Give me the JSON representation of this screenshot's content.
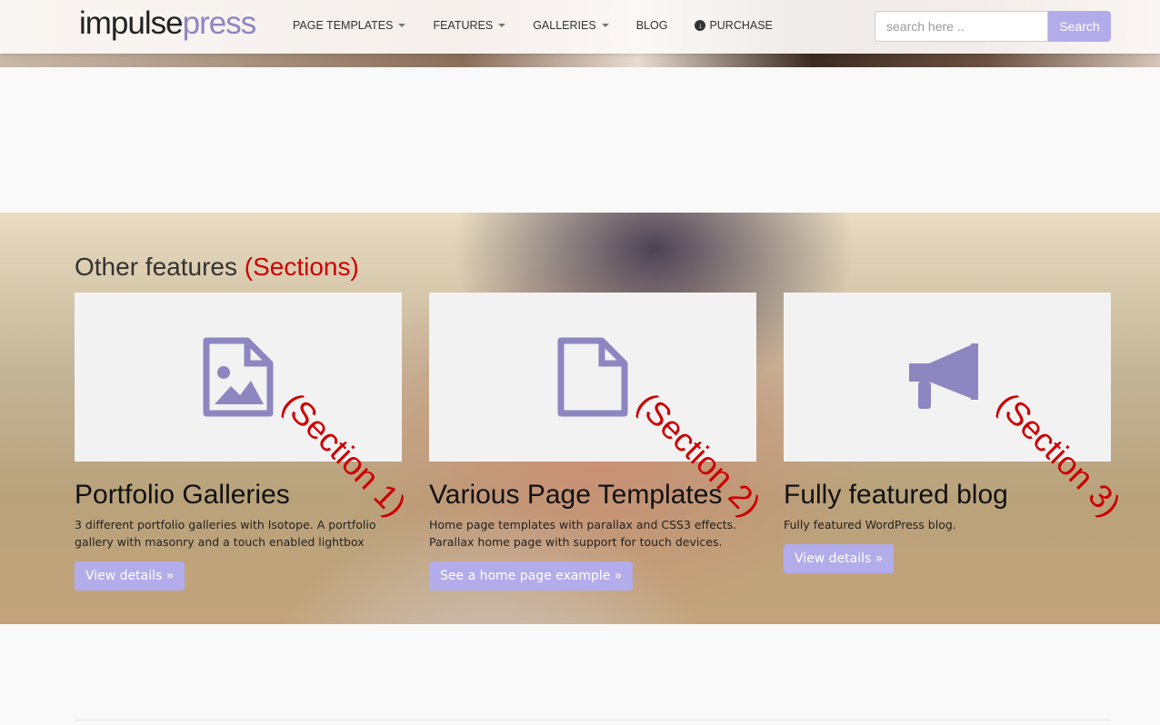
{
  "brand": {
    "part1": "impulse",
    "part2": "press"
  },
  "nav": {
    "items": [
      {
        "label": "PAGE TEMPLATES",
        "dropdown": true
      },
      {
        "label": "FEATURES",
        "dropdown": true
      },
      {
        "label": "GALLERIES",
        "dropdown": true
      },
      {
        "label": "BLOG",
        "dropdown": false
      },
      {
        "label": "PURCHASE",
        "icon": "circle-arrow-down-icon"
      }
    ]
  },
  "search": {
    "placeholder": "search here ..",
    "button": "Search"
  },
  "section": {
    "title": "Other features",
    "annotation": "(Sections)"
  },
  "cards": [
    {
      "icon": "image-file-icon",
      "title": "Portfolio Galleries",
      "text": "3 different portfolio galleries with Isotope. A portfolio gallery with masonry and a touch enabled lightbox",
      "button": "View details »",
      "annotation": "(Section 1)"
    },
    {
      "icon": "file-icon",
      "title": "Various Page Templates",
      "text": "Home page templates with parallax and CSS3 effects. Parallax home page with support for touch devices.",
      "button": "See a home page example »",
      "annotation": "(Section 2)"
    },
    {
      "icon": "megaphone-icon",
      "title": "Fully featured blog",
      "text": "Fully featured WordPress blog.",
      "button": "View details »",
      "annotation": "(Section 3)"
    }
  ],
  "colors": {
    "accent": "#b3acea",
    "icon": "#8e86c0",
    "annotation": "#cc0000"
  }
}
